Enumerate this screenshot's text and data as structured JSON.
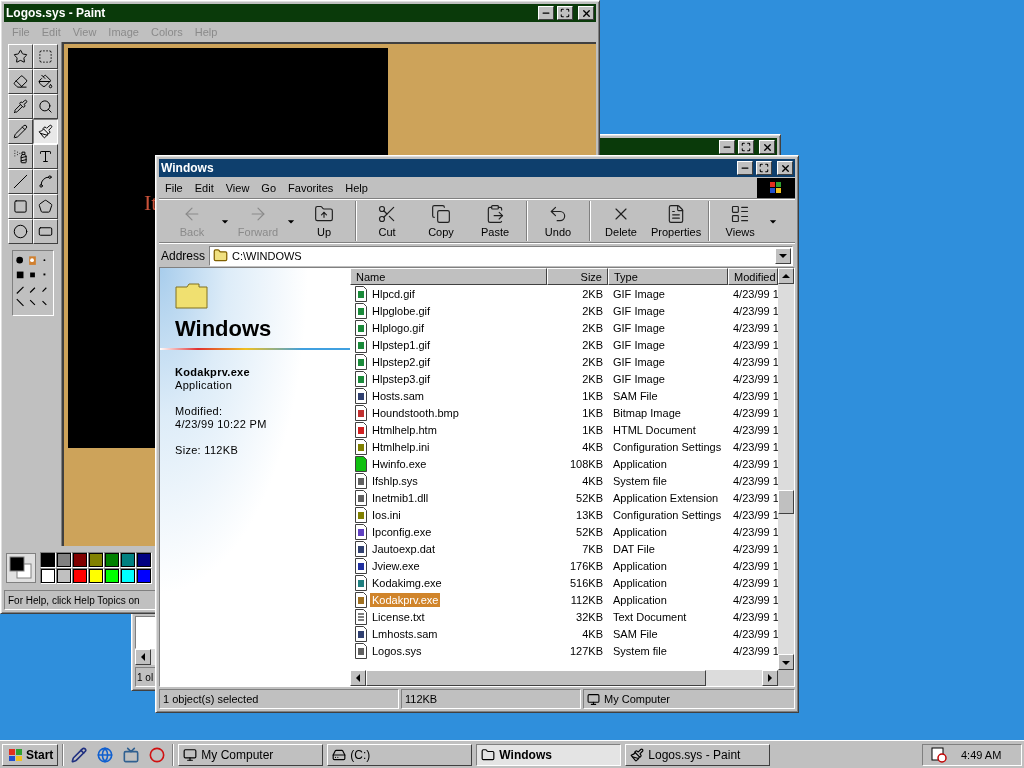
{
  "paint_window": {
    "title": "Logos.sys - Paint",
    "active": false,
    "menu": [
      {
        "label": "File",
        "disabled": true
      },
      {
        "label": "Edit",
        "disabled": true
      },
      {
        "label": "View",
        "disabled": true
      },
      {
        "label": "Image",
        "disabled": true
      },
      {
        "label": "Colors",
        "disabled": true
      },
      {
        "label": "Help",
        "disabled": true
      }
    ],
    "tools": [
      {
        "kind": "free-select",
        "selected": false
      },
      {
        "kind": "select",
        "selected": false
      },
      {
        "kind": "eraser",
        "selected": false
      },
      {
        "kind": "fill",
        "selected": false
      },
      {
        "kind": "picker",
        "selected": false
      },
      {
        "kind": "magnifier",
        "selected": false
      },
      {
        "kind": "pencil",
        "selected": false
      },
      {
        "kind": "brush",
        "selected": true
      },
      {
        "kind": "airbrush",
        "selected": false
      },
      {
        "kind": "text",
        "selected": false
      },
      {
        "kind": "line",
        "selected": false
      },
      {
        "kind": "curve",
        "selected": false
      },
      {
        "kind": "rectangle",
        "selected": false
      },
      {
        "kind": "polygon",
        "selected": false
      },
      {
        "kind": "ellipse",
        "selected": false
      },
      {
        "kind": "rounded-rectangle",
        "selected": false
      }
    ],
    "canvas_text": "It",
    "palette": [
      {
        "color": "#000000"
      },
      {
        "color": "#808080"
      },
      {
        "color": "#800000"
      },
      {
        "color": "#808000"
      },
      {
        "color": "#008000"
      },
      {
        "color": "#008080"
      },
      {
        "color": "#000080"
      },
      {
        "color": "#ffffff"
      },
      {
        "color": "#c0c0c0"
      },
      {
        "color": "#ff0000"
      },
      {
        "color": "#ffff00"
      },
      {
        "color": "#00ff00"
      },
      {
        "color": "#00ffff"
      },
      {
        "color": "#0000ff"
      }
    ],
    "status": "For Help, click Help Topics on"
  },
  "background_window": {
    "active": false,
    "status": "1 ol"
  },
  "explorer_window": {
    "title": "Windows",
    "active": true,
    "menu": [
      "File",
      "Edit",
      "View",
      "Go",
      "Favorites",
      "Help"
    ],
    "toolbar": [
      [
        {
          "kind": "back",
          "label": "Back",
          "disabled": true,
          "dropdown": true
        },
        {
          "kind": "forward",
          "label": "Forward",
          "disabled": true,
          "dropdown": true
        },
        {
          "kind": "up",
          "label": "Up",
          "disabled": false,
          "dropdown": false
        }
      ],
      [
        {
          "kind": "cut",
          "label": "Cut",
          "disabled": false,
          "dropdown": false
        },
        {
          "kind": "copy",
          "label": "Copy",
          "disabled": false,
          "dropdown": false
        },
        {
          "kind": "paste",
          "label": "Paste",
          "disabled": false,
          "dropdown": false
        }
      ],
      [
        {
          "kind": "undo",
          "label": "Undo",
          "disabled": false,
          "dropdown": false
        }
      ],
      [
        {
          "kind": "delete",
          "label": "Delete",
          "disabled": false,
          "dropdown": false
        },
        {
          "kind": "properties",
          "label": "Properties",
          "disabled": false,
          "dropdown": false
        }
      ],
      [
        {
          "kind": "views",
          "label": "Views",
          "disabled": false,
          "dropdown": true
        }
      ]
    ],
    "address": {
      "label": "Address",
      "value": "C:\\WINDOWS"
    },
    "info_panel": {
      "folder_title": "Windows",
      "file_name": "Kodakprv.exe",
      "file_type": "Application",
      "modified_label": "Modified:",
      "modified_value": "4/23/99 10:22 PM",
      "size": "Size: 112KB"
    },
    "columns": [
      "Name",
      "Size",
      "Type",
      "Modified"
    ],
    "rows": [
      {
        "kind": "gif",
        "name": "Hlpcd.gif",
        "size": "2KB",
        "type": "GIF Image",
        "modified": "4/23/99 1",
        "selected": false
      },
      {
        "kind": "gif",
        "name": "Hlpglobe.gif",
        "size": "2KB",
        "type": "GIF Image",
        "modified": "4/23/99 1",
        "selected": false
      },
      {
        "kind": "gif",
        "name": "Hlplogo.gif",
        "size": "2KB",
        "type": "GIF Image",
        "modified": "4/23/99 1",
        "selected": false
      },
      {
        "kind": "gif",
        "name": "Hlpstep1.gif",
        "size": "2KB",
        "type": "GIF Image",
        "modified": "4/23/99 1",
        "selected": false
      },
      {
        "kind": "gif",
        "name": "Hlpstep2.gif",
        "size": "2KB",
        "type": "GIF Image",
        "modified": "4/23/99 1",
        "selected": false
      },
      {
        "kind": "gif",
        "name": "Hlpstep3.gif",
        "size": "2KB",
        "type": "GIF Image",
        "modified": "4/23/99 1",
        "selected": false
      },
      {
        "kind": "sam",
        "name": "Hosts.sam",
        "size": "1KB",
        "type": "SAM File",
        "modified": "4/23/99 1",
        "selected": false
      },
      {
        "kind": "bmp",
        "name": "Houndstooth.bmp",
        "size": "1KB",
        "type": "Bitmap Image",
        "modified": "4/23/99 1",
        "selected": false
      },
      {
        "kind": "htm",
        "name": "Htmlhelp.htm",
        "size": "1KB",
        "type": "HTML Document",
        "modified": "4/23/99 1",
        "selected": false
      },
      {
        "kind": "ini",
        "name": "Htmlhelp.ini",
        "size": "4KB",
        "type": "Configuration Settings",
        "modified": "4/23/99 1",
        "selected": false
      },
      {
        "kind": "hwinfo",
        "name": "Hwinfo.exe",
        "size": "108KB",
        "type": "Application",
        "modified": "4/23/99 1",
        "selected": false
      },
      {
        "kind": "sys",
        "name": "Ifshlp.sys",
        "size": "4KB",
        "type": "System file",
        "modified": "4/23/99 1",
        "selected": false
      },
      {
        "kind": "sys",
        "name": "Inetmib1.dll",
        "size": "52KB",
        "type": "Application Extension",
        "modified": "4/23/99 1",
        "selected": false
      },
      {
        "kind": "ini",
        "name": "Ios.ini",
        "size": "13KB",
        "type": "Configuration Settings",
        "modified": "4/23/99 1",
        "selected": false
      },
      {
        "kind": "ipconfig",
        "name": "Ipconfig.exe",
        "size": "52KB",
        "type": "Application",
        "modified": "4/23/99 1",
        "selected": false
      },
      {
        "kind": "sam",
        "name": "Jautoexp.dat",
        "size": "7KB",
        "type": "DAT File",
        "modified": "4/23/99 1",
        "selected": false
      },
      {
        "kind": "jview",
        "name": "Jview.exe",
        "size": "176KB",
        "type": "Application",
        "modified": "4/23/99 1",
        "selected": false
      },
      {
        "kind": "kodak",
        "name": "Kodakimg.exe",
        "size": "516KB",
        "type": "Application",
        "modified": "4/23/99 1",
        "selected": false
      },
      {
        "kind": "kodakprv",
        "name": "Kodakprv.exe",
        "size": "112KB",
        "type": "Application",
        "modified": "4/23/99 1",
        "selected": true
      },
      {
        "kind": "txt",
        "name": "License.txt",
        "size": "32KB",
        "type": "Text Document",
        "modified": "4/23/99 1",
        "selected": false
      },
      {
        "kind": "sam",
        "name": "Lmhosts.sam",
        "size": "4KB",
        "type": "SAM File",
        "modified": "4/23/99 1",
        "selected": false
      },
      {
        "kind": "sys",
        "name": "Logos.sys",
        "size": "127KB",
        "type": "System file",
        "modified": "4/23/99 1",
        "selected": false
      }
    ],
    "status": [
      "1 object(s) selected",
      "112KB",
      "My Computer"
    ]
  },
  "taskbar": {
    "start": "Start",
    "quick_launch": [
      {
        "kind": "desktop"
      },
      {
        "kind": "browser"
      },
      {
        "kind": "channels"
      },
      {
        "kind": "opera"
      }
    ],
    "tasks": [
      {
        "kind": "computer",
        "label": "My Computer",
        "selected": false
      },
      {
        "kind": "drive",
        "label": "(C:)",
        "selected": false
      },
      {
        "kind": "folder",
        "label": "Windows",
        "selected": true
      },
      {
        "kind": "paint",
        "label": "Logos.sys - Paint",
        "selected": false
      }
    ],
    "clock": "4:49 AM"
  }
}
